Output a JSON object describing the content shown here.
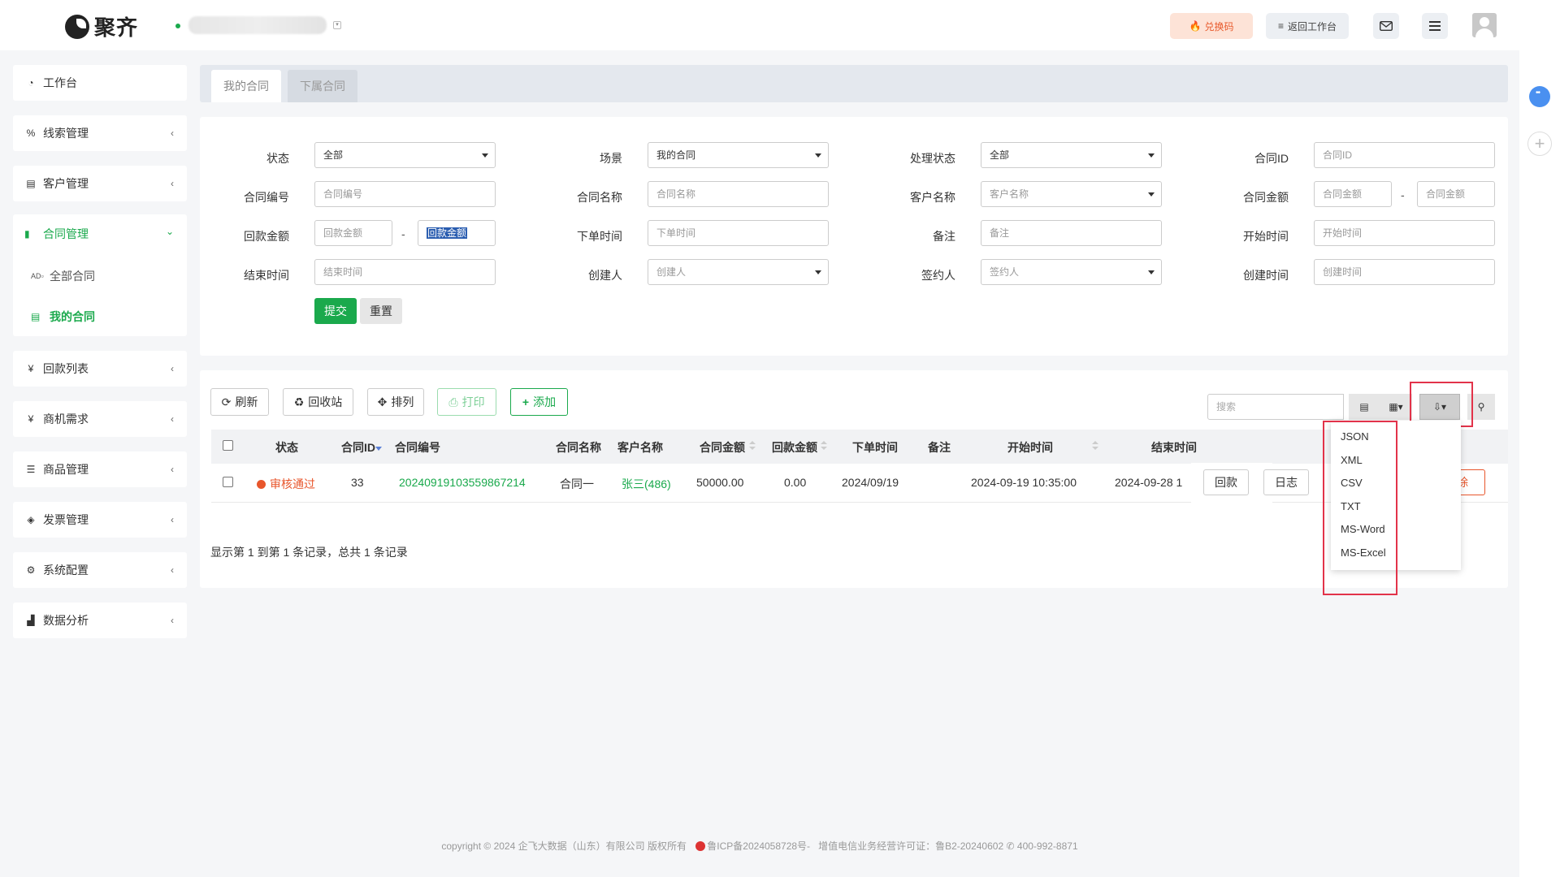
{
  "header": {
    "logo_text": "聚齐",
    "redeem_label": "兑换码",
    "back_label": "返回工作台"
  },
  "sidebar": {
    "items": [
      {
        "label": "工作台",
        "icon": "dashboard-icon"
      },
      {
        "label": "线索管理",
        "icon": "link-icon"
      },
      {
        "label": "客户管理",
        "icon": "id-card-icon"
      },
      {
        "label": "合同管理",
        "icon": "bookmark-icon",
        "expanded": true
      },
      {
        "label": "全部合同",
        "icon": "ad-icon"
      },
      {
        "label": "我的合同",
        "icon": "list-alt-icon",
        "active": true
      },
      {
        "label": "回款列表",
        "icon": "yen-icon"
      },
      {
        "label": "商机需求",
        "icon": "yen-icon"
      },
      {
        "label": "商品管理",
        "icon": "list-icon"
      },
      {
        "label": "发票管理",
        "icon": "tag-icon"
      },
      {
        "label": "系统配置",
        "icon": "cogs-icon"
      },
      {
        "label": "数据分析",
        "icon": "bar-chart-icon"
      }
    ]
  },
  "tabs": [
    {
      "label": "我的合同",
      "active": true
    },
    {
      "label": "下属合同",
      "active": false
    }
  ],
  "filters": {
    "status": {
      "label": "状态",
      "value": "全部"
    },
    "scene": {
      "label": "场景",
      "value": "我的合同"
    },
    "process_status": {
      "label": "处理状态",
      "value": "全部"
    },
    "contract_id": {
      "label": "合同ID",
      "placeholder": "合同ID"
    },
    "contract_no": {
      "label": "合同编号",
      "placeholder": "合同编号"
    },
    "contract_name": {
      "label": "合同名称",
      "placeholder": "合同名称"
    },
    "customer_name": {
      "label": "客户名称",
      "placeholder": "客户名称"
    },
    "contract_amount": {
      "label": "合同金额",
      "placeholder_min": "合同金额",
      "placeholder_max": "合同金额"
    },
    "payment_amount": {
      "label": "回款金额",
      "placeholder_min": "回款金额",
      "value_max": "回款金额"
    },
    "order_time": {
      "label": "下单时间",
      "placeholder": "下单时间"
    },
    "remark": {
      "label": "备注",
      "placeholder": "备注"
    },
    "start_time": {
      "label": "开始时间",
      "placeholder": "开始时间"
    },
    "end_time": {
      "label": "结束时间",
      "placeholder": "结束时间"
    },
    "creator": {
      "label": "创建人",
      "placeholder": "创建人"
    },
    "signer": {
      "label": "签约人",
      "placeholder": "签约人"
    },
    "create_time": {
      "label": "创建时间",
      "placeholder": "创建时间"
    },
    "range_separator": "-",
    "submit_label": "提交",
    "reset_label": "重置"
  },
  "toolbar": {
    "refresh_label": "刷新",
    "recycle_label": "回收站",
    "arrange_label": "排列",
    "print_label": "打印",
    "add_label": "添加",
    "search_placeholder": "搜索"
  },
  "table": {
    "columns": [
      "状态",
      "合同ID",
      "合同编号",
      "合同名称",
      "客户名称",
      "合同金额",
      "回款金额",
      "下单时间",
      "备注",
      "开始时间",
      "结束时间"
    ],
    "rows": [
      {
        "status": "审核通过",
        "id": "33",
        "number": "20240919103559867214",
        "name": "合同一",
        "customer": "张三(486)",
        "amount": "50000.00",
        "paid": "0.00",
        "order_date": "2024/09/19",
        "remark": "",
        "start": "2024-09-19 10:35:00",
        "end": "2024-09-28 1"
      }
    ],
    "row_actions": [
      "回款",
      "日志",
      "删除"
    ],
    "delete_visible": "除"
  },
  "pager_text": "显示第 1 到第 1 条记录，总共 1 条记录",
  "export_menu": [
    "JSON",
    "XML",
    "CSV",
    "TXT",
    "MS-Word",
    "MS-Excel"
  ],
  "footer": {
    "copyright": "copyright © 2024 企飞大数据（山东）有限公司 版权所有",
    "icp": "鲁ICP备2024058728号-",
    "license": "增值电信业务经营许可证：鲁B2-20240602",
    "phone": "400-992-8871"
  },
  "colors": {
    "primary": "#1aa94c",
    "danger": "#e8562c",
    "highlight_box": "#e2334a"
  }
}
